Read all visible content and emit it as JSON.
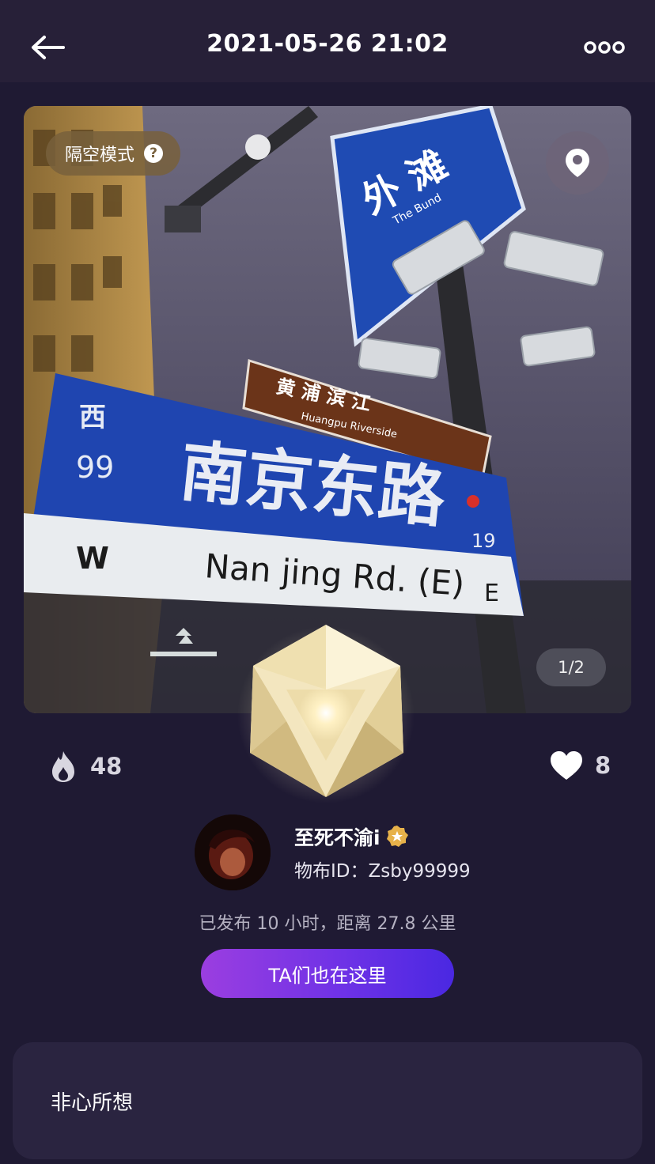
{
  "header": {
    "title": "2021-05-26 21:02"
  },
  "photo": {
    "mode_label": "隔空模式",
    "help_glyph": "?",
    "page_indicator": "1/2",
    "sign_bund_cn": "外 滩",
    "sign_bund_en": "The Bund",
    "sign_huangpu_cn": "黄 浦 滨 江",
    "sign_huangpu_en": "Huangpu Riverside",
    "sign_road_cn": "南京东路",
    "sign_road_en": "Nan jing Rd. (E)",
    "sign_west": "西",
    "sign_num": "99",
    "sign_w": "W",
    "sign_e": "E",
    "sign_19": "19"
  },
  "stats": {
    "heat": "48",
    "likes": "8"
  },
  "user": {
    "name": "至死不渝i",
    "id_line": "物布ID：Zsby99999",
    "meta": "已发布 10 小时，距离 27.8 公里"
  },
  "cta_label": "TA们也在这里",
  "card_text": "非心所想",
  "colors": {
    "background": "#1f1a33",
    "topbar": "#272038",
    "cta_start": "#9b3ee0",
    "cta_end": "#4a28e2",
    "badge": "#e7b24a"
  },
  "icons": [
    "back-arrow-icon",
    "more-dots-icon",
    "help-icon",
    "location-pin-icon",
    "flame-icon",
    "heart-icon",
    "star-badge-icon"
  ]
}
